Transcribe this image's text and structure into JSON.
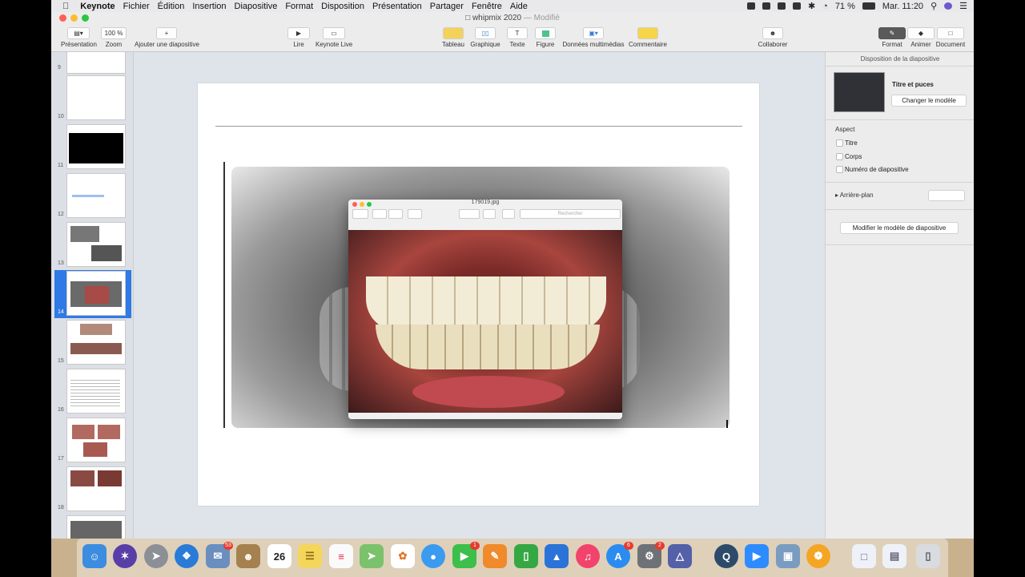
{
  "menubar": {
    "app": "Keynote",
    "items": [
      "Fichier",
      "Édition",
      "Insertion",
      "Diapositive",
      "Format",
      "Disposition",
      "Présentation",
      "Partager",
      "Fenêtre",
      "Aide"
    ],
    "battery": "71 %",
    "clock": "Mar. 11:20"
  },
  "window": {
    "title": "whipmix 2020",
    "status": "— Modifié"
  },
  "toolbar": {
    "view": "Présentation",
    "zoom_value": "100 %",
    "zoom_label": "Zoom",
    "add_slide": "Ajouter une diapositive",
    "play": "Lire",
    "keynote_live": "Keynote Live",
    "table": "Tableau",
    "chart": "Graphique",
    "text": "Texte",
    "shape": "Figure",
    "media": "Données multimédias",
    "comment": "Commentaire",
    "collaborate": "Collaborer",
    "format": "Format",
    "animate": "Animer",
    "document": "Document"
  },
  "navigator": {
    "slides": [
      "9",
      "10",
      "11",
      "12",
      "13",
      "14",
      "15",
      "16",
      "17",
      "18"
    ],
    "selected": "14"
  },
  "preview_window": {
    "title": "179019.jpg",
    "search_placeholder": "Rechercher"
  },
  "inspector": {
    "header": "Disposition de la diapositive",
    "template_name": "Titre et puces",
    "change_template": "Changer le modèle",
    "appearance": "Aspect",
    "options": [
      {
        "label": "Titre",
        "checked": false
      },
      {
        "label": "Corps",
        "checked": false
      },
      {
        "label": "Numéro de diapositive",
        "checked": false
      }
    ],
    "background": "Arrière-plan",
    "edit_master": "Modifier le modèle de diapositive"
  },
  "dock": {
    "badges": {
      "mail": "53",
      "calendar_day": "26",
      "facetime": "1",
      "appstore": "6",
      "preferences": "2"
    }
  }
}
